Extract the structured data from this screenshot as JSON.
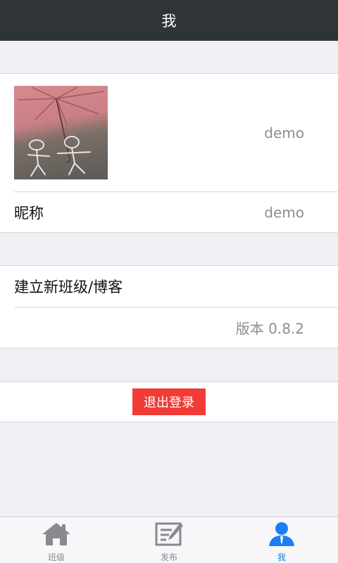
{
  "header": {
    "title": "我"
  },
  "profile": {
    "avatar_icon": "umbrella-photo",
    "avatar_name": "demo",
    "nickname_label": "昵称",
    "nickname_value": "demo"
  },
  "actions": {
    "create_class_label": "建立新班级/博客",
    "version_text": "版本 0.8.2"
  },
  "logout": {
    "label": "退出登录",
    "color": "#f23b36"
  },
  "tabbar": {
    "items": [
      {
        "label": "班级",
        "icon": "home-icon",
        "active": false
      },
      {
        "label": "发布",
        "icon": "edit-icon",
        "active": false
      },
      {
        "label": "我",
        "icon": "person-icon",
        "active": true
      }
    ],
    "active_color": "#1a7ff5",
    "inactive_color": "#8a8a8e"
  }
}
